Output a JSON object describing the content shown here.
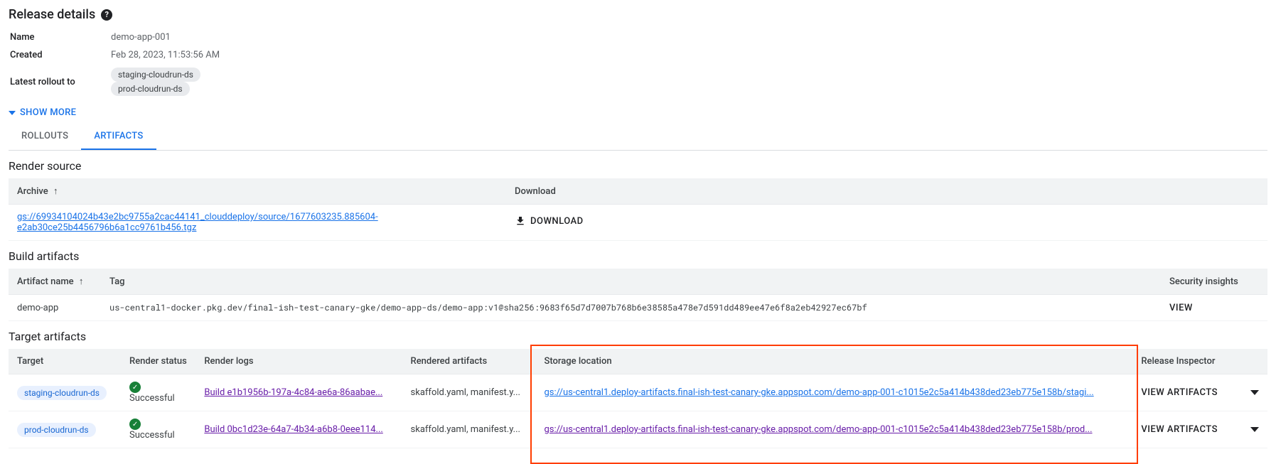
{
  "header": {
    "title": "Release details"
  },
  "details": {
    "name_label": "Name",
    "name_value": "demo-app-001",
    "created_label": "Created",
    "created_value": "Feb 28, 2023, 11:53:56 AM",
    "rollout_label": "Latest rollout to",
    "rollout_chip1": "staging-cloudrun-ds",
    "rollout_chip2": "prod-cloudrun-ds"
  },
  "show_more": "SHOW MORE",
  "tabs": {
    "rollouts": "ROLLOUTS",
    "artifacts": "ARTIFACTS"
  },
  "render_source": {
    "heading": "Render source",
    "col_archive": "Archive",
    "col_download": "Download",
    "archive_link": "gs://69934104024b43e2bc9755a2cac44141_clouddeploy/source/1677603235.885604-e2ab30ce25b4456796b6a1cc9761b456.tgz",
    "download_btn": "DOWNLOAD"
  },
  "build_artifacts": {
    "heading": "Build artifacts",
    "col_name": "Artifact name",
    "col_tag": "Tag",
    "col_insights": "Security insights",
    "row_name": "demo-app",
    "row_tag": "us-central1-docker.pkg.dev/final-ish-test-canary-gke/demo-app-ds/demo-app:v1@sha256:9683f65d7d7007b768b6e38585a478e7d591dd489ee47e6f8a2eb42927ec67bf",
    "view": "VIEW"
  },
  "target_artifacts": {
    "heading": "Target artifacts",
    "col_target": "Target",
    "col_status": "Render status",
    "col_logs": "Render logs",
    "col_rendered": "Rendered artifacts",
    "col_storage": "Storage location",
    "col_inspector": "Release Inspector",
    "rows": [
      {
        "target": "staging-cloudrun-ds",
        "status": "Successful",
        "log_link": "Build e1b1956b-197a-4c84-ae6a-86aabae...",
        "rendered": "skaffold.yaml, manifest.y...",
        "storage": "gs://us-central1.deploy-artifacts.final-ish-test-canary-gke.appspot.com/demo-app-001-c1015e2c5a414b438ded23eb775e158b/stagi...",
        "inspector": "VIEW ARTIFACTS"
      },
      {
        "target": "prod-cloudrun-ds",
        "status": "Successful",
        "log_link": "Build 0bc1d23e-64a7-4b34-a6b8-0eee114...",
        "rendered": "skaffold.yaml, manifest.y...",
        "storage": "gs://us-central1.deploy-artifacts.final-ish-test-canary-gke.appspot.com/demo-app-001-c1015e2c5a414b438ded23eb775e158b/prod...",
        "inspector": "VIEW ARTIFACTS"
      }
    ]
  }
}
